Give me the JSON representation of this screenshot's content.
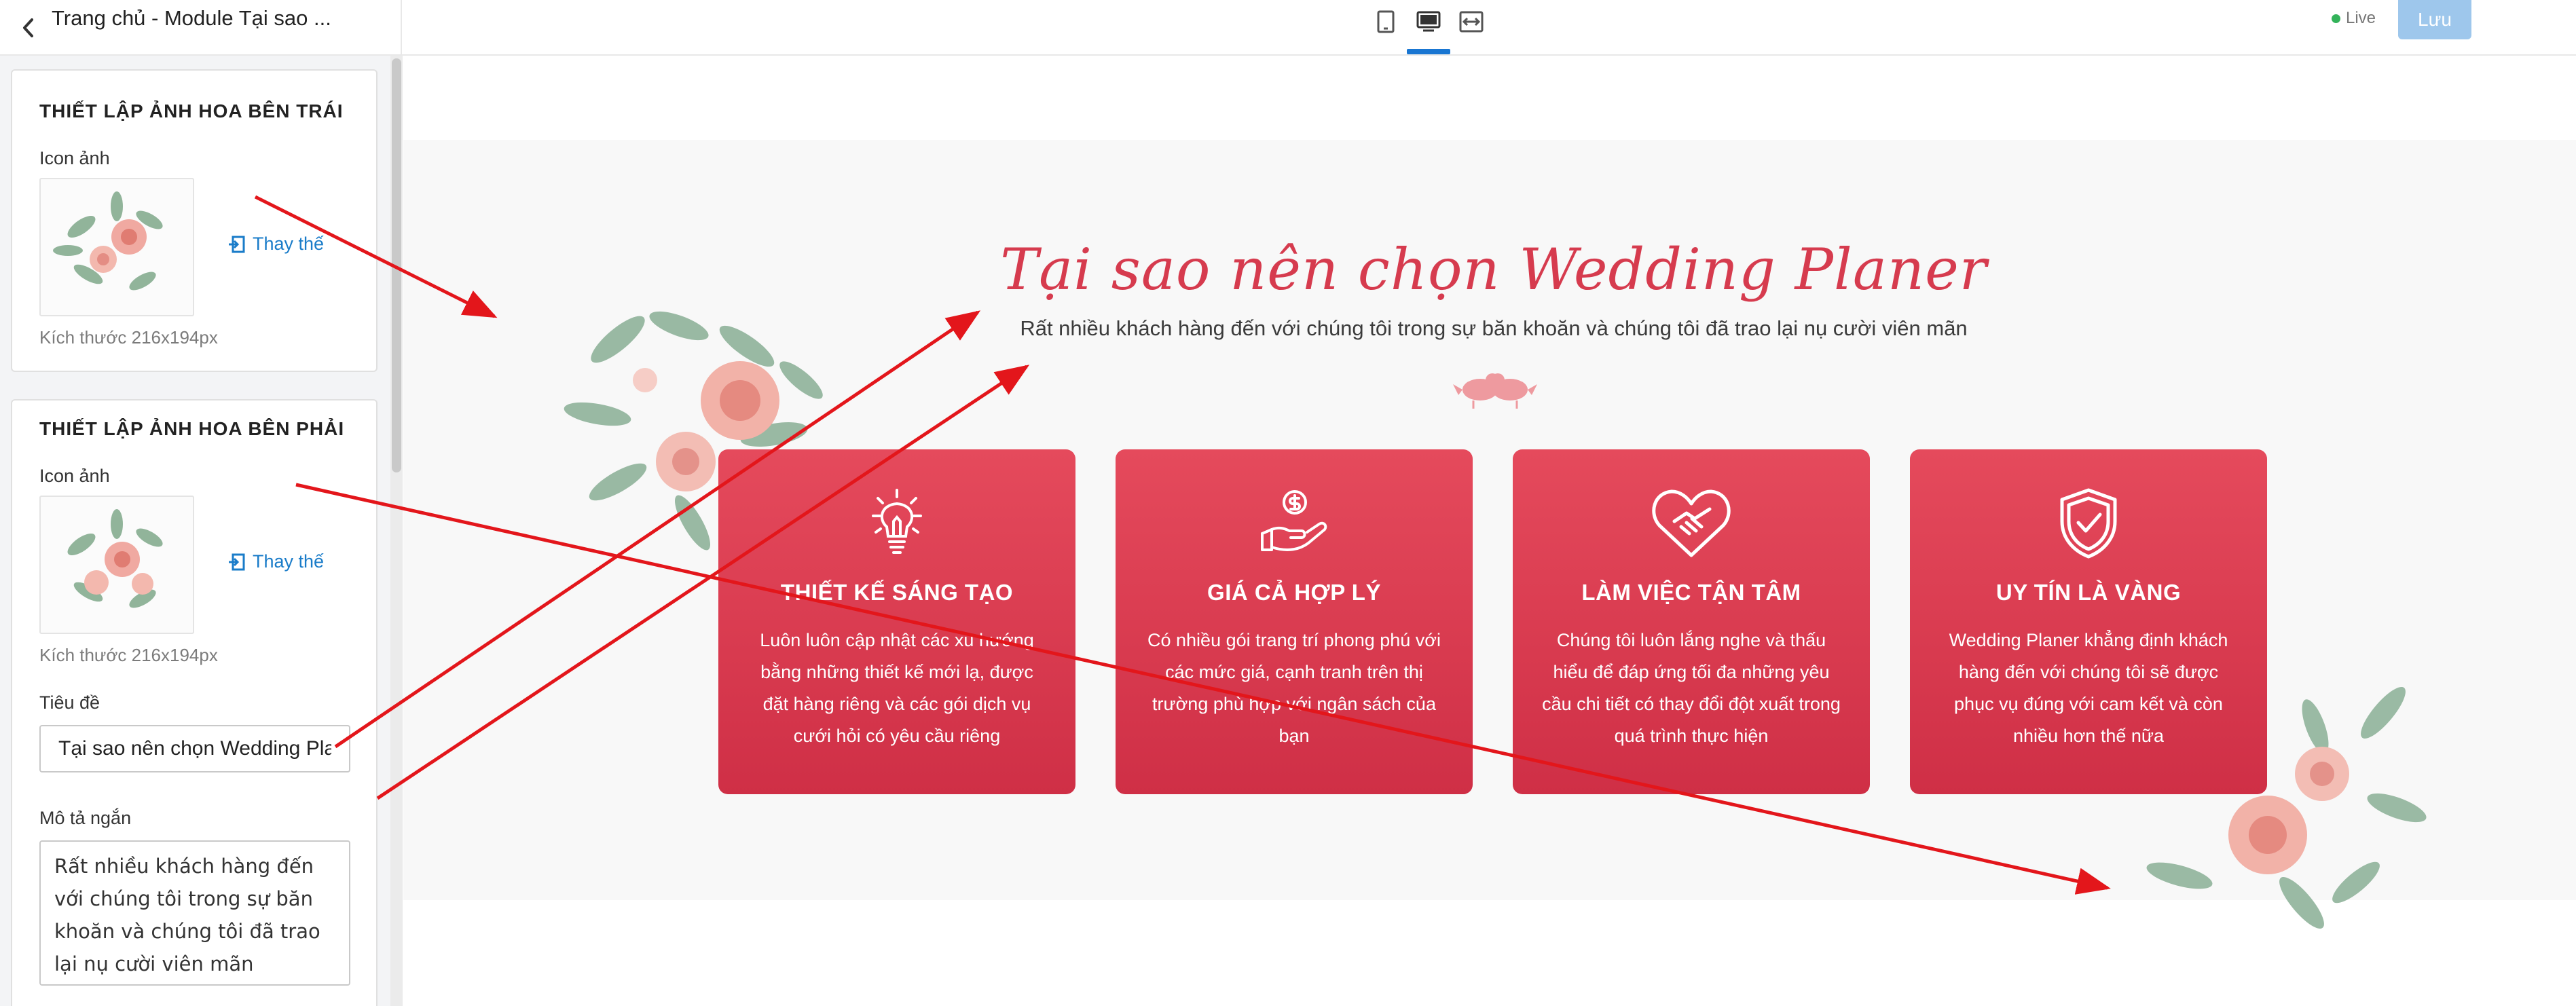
{
  "header": {
    "title": "Trang chủ - Module Tại sao ...",
    "devices": [
      {
        "name": "mobile",
        "icon": "mobile-icon"
      },
      {
        "name": "desktop",
        "icon": "desktop-icon",
        "active": true
      },
      {
        "name": "fullwidth",
        "icon": "fullwidth-icon"
      }
    ],
    "live_label": "Live",
    "save_label": "Lưu",
    "accent_color": "#1976d2"
  },
  "sidebar": {
    "left_flower": {
      "title": "THIẾT LẬP ẢNH HOA BÊN TRÁI",
      "icon_label": "Icon ảnh",
      "replace_label": "Thay thế",
      "size_text": "Kích thước 216x194px"
    },
    "right_flower": {
      "title": "THIẾT LẬP ẢNH HOA BÊN PHẢI",
      "icon_label": "Icon ảnh",
      "replace_label": "Thay thế",
      "size_text": "Kích thước 216x194px"
    },
    "title_field": {
      "label": "Tiêu đề",
      "value": "Tại sao nên chọn Wedding Planer"
    },
    "description_field": {
      "label": "Mô tả ngắn",
      "value": "Rất nhiều khách hàng đến với chúng tôi trong sự băn khoăn và chúng tôi đã trao lại nụ cười viên mãn"
    }
  },
  "preview": {
    "title": "Tại sao nên chọn Wedding Planer",
    "subtitle": "Rất nhiều khách hàng đến với chúng tôi trong sự băn khoăn và chúng tôi đã trao lại nụ cười viên mãn",
    "brand_color": "#d63b4e",
    "features": [
      {
        "icon": "lightbulb-icon",
        "title": "THIẾT KẾ SÁNG TẠO",
        "description": "Luôn luôn cập nhật các xu hướng bằng những thiết kế mới lạ, được đặt hàng riêng và các gói dịch vụ cưới hỏi có yêu cầu riêng"
      },
      {
        "icon": "hand-coin-icon",
        "title": "GIÁ CẢ HỢP LÝ",
        "description": "Có nhiều gói trang trí phong phú với các mức giá, cạnh tranh trên thị trường phù hợp với ngân sách của bạn"
      },
      {
        "icon": "heart-handshake-icon",
        "title": "LÀM VIỆC TẬN TÂM",
        "description": "Chúng tôi luôn lắng nghe và thấu hiểu để đáp ứng tối đa những yêu cầu chi tiết có thay đổi đột xuất trong quá trình thực hiện"
      },
      {
        "icon": "shield-check-icon",
        "title": "UY TÍN LÀ VÀNG",
        "description": "Wedding Planer khẳng định khách hàng đến với chúng tôi sẽ được phục vụ đúng với cam kết và còn nhiều hơn thế nữa"
      }
    ]
  }
}
